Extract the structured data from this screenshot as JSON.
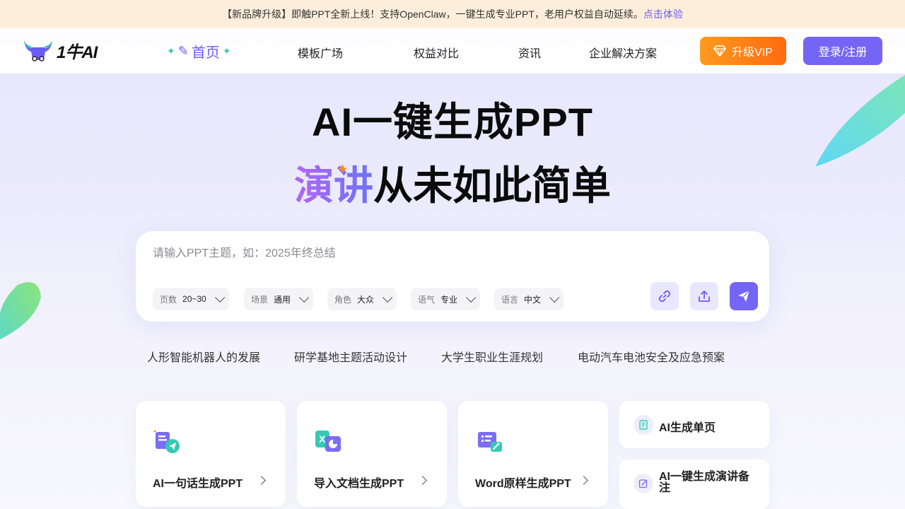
{
  "banner": {
    "text": "【新品牌升级】即触PPT全新上线！支持OpenClaw，一键生成专业PPT，老用户权益自动延续。",
    "link": "点击体验"
  },
  "nav": {
    "logo_text": "1牛AI",
    "home": "首页",
    "items": [
      "模板广场",
      "权益对比",
      "资讯",
      "企业解决方案"
    ],
    "vip_label": "升级VIP",
    "login_label": "登录/注册"
  },
  "hero": {
    "title": "AI一键生成PPT",
    "sub_highlight": "演讲",
    "sub_rest": "从未如此简单"
  },
  "input": {
    "placeholder": "请输入PPT主题，如：2025年终总结",
    "options": [
      {
        "label": "页数",
        "value": "20~30"
      },
      {
        "label": "场景",
        "value": "通用"
      },
      {
        "label": "角色",
        "value": "大众"
      },
      {
        "label": "语气",
        "value": "专业"
      },
      {
        "label": "语言",
        "value": "中文"
      }
    ]
  },
  "suggestions": [
    "人形智能机器人的发展",
    "研学基地主题活动设计",
    "大学生职业生涯规划",
    "电动汽车电池安全及应急预案"
  ],
  "cards": [
    {
      "label": "AI一句话生成PPT",
      "icon": "doc-send-icon"
    },
    {
      "label": "导入文档生成PPT",
      "icon": "excel-chart-icon"
    },
    {
      "label": "Word原样生成PPT",
      "icon": "word-magic-icon"
    }
  ],
  "side_cards": [
    {
      "label": "AI生成单页",
      "icon": "page-icon"
    },
    {
      "label": "AI一键生成演讲备注",
      "icon": "edit-note-icon"
    }
  ],
  "colors": {
    "accent": "#7565f4",
    "vip": "#ff7a14",
    "banner_bg": "#fdeedc"
  }
}
